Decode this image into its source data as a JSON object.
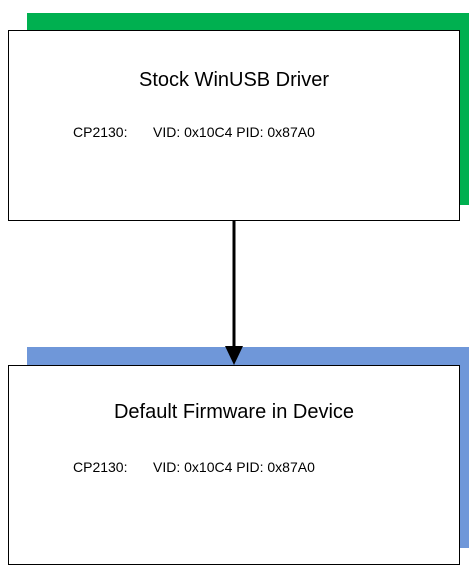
{
  "colors": {
    "top_shadow": "#00b050",
    "bottom_shadow": "#6f97d9",
    "border": "#000000",
    "arrow": "#000000"
  },
  "top_box": {
    "title": "Stock WinUSB Driver",
    "chip": "CP2130:",
    "ids": "VID: 0x10C4 PID: 0x87A0"
  },
  "bottom_box": {
    "title": "Default Firmware in Device",
    "chip": "CP2130:",
    "ids": "VID: 0x10C4 PID: 0x87A0"
  }
}
